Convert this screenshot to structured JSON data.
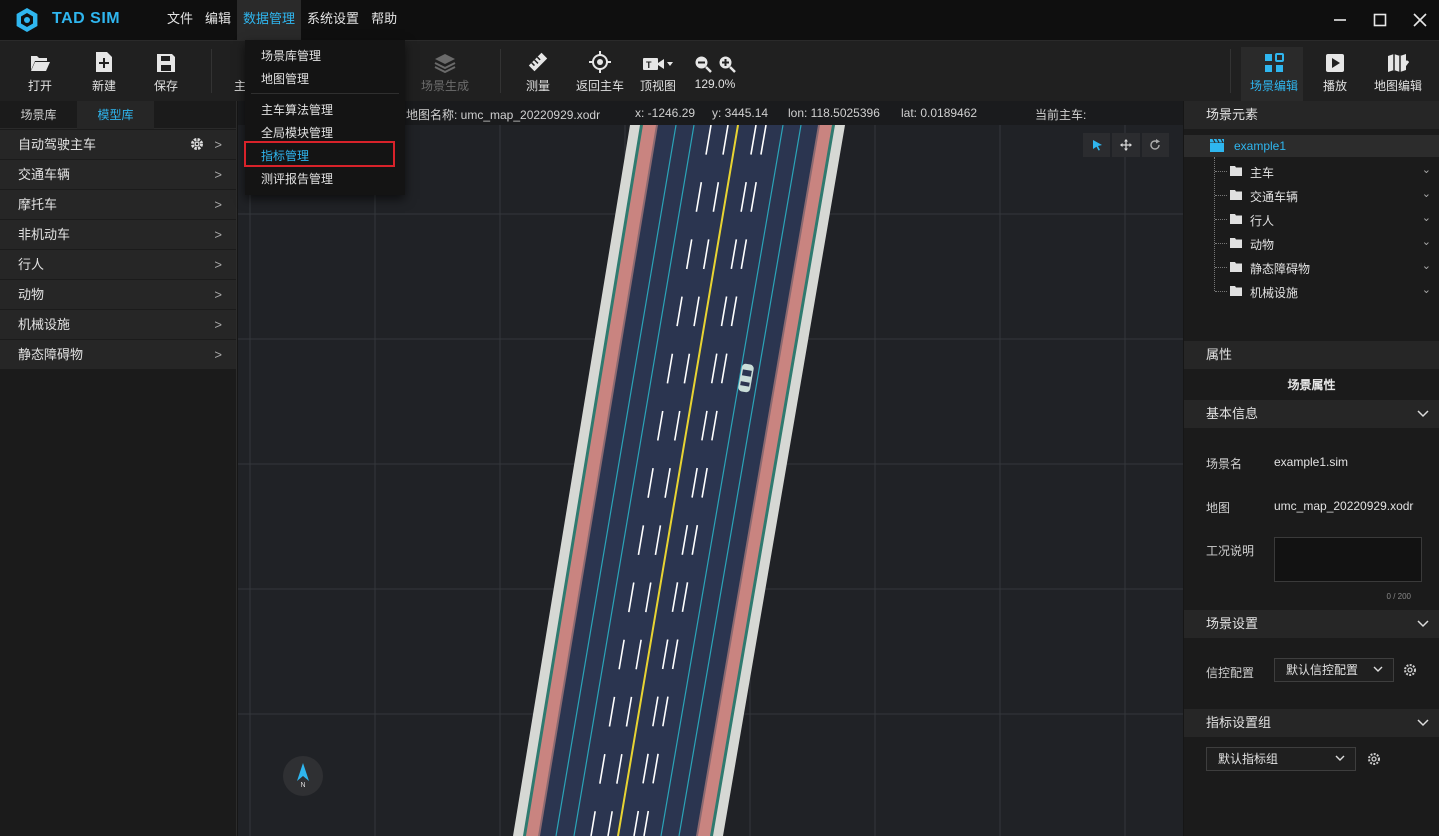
{
  "app": {
    "brand": "TAD SIM"
  },
  "menu": [
    "文件",
    "编辑",
    "数据管理",
    "系统设置",
    "帮助"
  ],
  "toolbar": {
    "open": "打开",
    "new": "新建",
    "save": "保存",
    "partial": "主",
    "scene_gen": "场景生成",
    "measure": "测量",
    "return_main": "返回主车",
    "top_view": "顶视图",
    "zoom": "129.0%",
    "scene_edit": "场景编辑",
    "play": "播放",
    "map_edit": "地图编辑"
  },
  "dropdown": {
    "items": [
      "场景库管理",
      "地图管理",
      "主车算法管理",
      "全局模块管理",
      "指标管理",
      "测评报告管理"
    ]
  },
  "left": {
    "tabs": [
      "场景库",
      "模型库"
    ],
    "categories": [
      "自动驾驶主车",
      "交通车辆",
      "摩托车",
      "非机动车",
      "行人",
      "动物",
      "机械设施",
      "静态障碍物"
    ]
  },
  "infobar": {
    "map_name": "地图名称: umc_map_20220929.xodr",
    "x": "x: -1246.29",
    "y": "y: 3445.14",
    "lon": "lon: 118.5025396",
    "lat": "lat: 0.0189462",
    "current": "当前主车:"
  },
  "compass": {
    "n": "N"
  },
  "right": {
    "elements_title": "场景元素",
    "root": "example1",
    "tree": [
      "主车",
      "交通车辆",
      "行人",
      "动物",
      "静态障碍物",
      "机械设施"
    ],
    "props_title": "属性",
    "scene_props": "场景属性",
    "basic_info": "基本信息",
    "scene_name_label": "场景名",
    "scene_name": "example1.sim",
    "map_label": "地图",
    "map_value": "umc_map_20220929.xodr",
    "condition_label": "工况说明",
    "counter": "0 / 200",
    "scene_settings": "场景设置",
    "signal_label": "信控配置",
    "signal_value": "默认信控配置",
    "indicator_group": "指标设置组",
    "indicator_value": "默认指标组"
  },
  "colors": {
    "accent": "#2fb6ef",
    "highlight": "#d8222a"
  }
}
